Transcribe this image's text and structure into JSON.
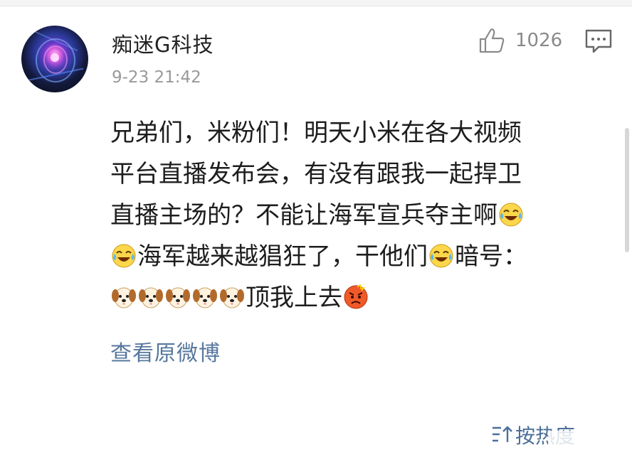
{
  "post": {
    "username": "痴迷G科技",
    "timestamp": "9-23 21:42",
    "like_count": "1026",
    "content_lines": [
      [
        {
          "t": "兄弟们，米粉们！明天小米在各大视频"
        }
      ],
      [
        {
          "t": "平台直播发布会，有没有跟我一起捍卫"
        }
      ],
      [
        {
          "t": "直播主场的？不能让海军宣兵夺主啊"
        },
        {
          "e": "laugh-cry-emoji"
        }
      ],
      [
        {
          "e": "laugh-cry-emoji"
        },
        {
          "t": "海军越来越猖狂了，干他们"
        },
        {
          "e": "laugh-cry-emoji"
        },
        {
          "t": "暗号："
        }
      ],
      [
        {
          "e": "dog-emoji"
        },
        {
          "e": "dog-emoji"
        },
        {
          "e": "dog-emoji"
        },
        {
          "e": "dog-emoji"
        },
        {
          "e": "dog-emoji"
        },
        {
          "t": "顶我上去"
        },
        {
          "e": "angry-emoji"
        }
      ]
    ],
    "view_original_label": "查看原微博"
  },
  "footer": {
    "sort_label": "按热度"
  },
  "icons": {
    "like": "thumbs-up-icon",
    "comment": "comment-icon",
    "sort": "sort-icon"
  },
  "colors": {
    "link": "#56779e",
    "muted": "#999999",
    "text": "#1d1d1d"
  }
}
